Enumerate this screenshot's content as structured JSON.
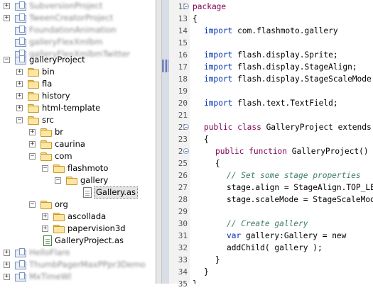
{
  "project_tree": {
    "blurred_top": [
      "SubversionProject",
      "TweenCreatorProject",
      "FoundationAnimation",
      "galleryFlexXmlbm",
      "galleryFlexXmlbmTwitter"
    ],
    "project_name": "galleryProject",
    "folders_top": [
      "bin",
      "fla",
      "history",
      "html-template"
    ],
    "src": "src",
    "src_children": [
      "br",
      "caurina",
      "com"
    ],
    "flashmoto": "flashmoto",
    "gallery": "gallery",
    "selected_file": "Gallery.as",
    "org": "org",
    "org_children": [
      "ascollada",
      "papervision3d"
    ],
    "main_file": "GalleryProject.as",
    "blurred_bottom": [
      "HelloFlare",
      "ThumbPagerMaxPPpr3Demo",
      "MxTimeWl"
    ]
  },
  "editor": {
    "line_numbers": [
      "12",
      "13",
      "14",
      "15",
      "16",
      "17",
      "18",
      "19",
      "20",
      "21",
      "22",
      "23",
      "24",
      "25",
      "26",
      "27",
      "28",
      "29",
      "30",
      "31",
      "32",
      "33",
      "34",
      "35"
    ],
    "lines": [
      {
        "kw": "package",
        "text": ""
      },
      {
        "kw": "",
        "text": "{"
      },
      {
        "kw": "import",
        "text": " com.flashmoto.gallery"
      },
      {
        "kw": "",
        "text": ""
      },
      {
        "kw": "import",
        "text": " flash.display.Sprite;"
      },
      {
        "kw": "import",
        "text": " flash.display.StageAlign;"
      },
      {
        "kw": "import",
        "text": " flash.display.StageScaleMode;"
      },
      {
        "kw": "",
        "text": ""
      },
      {
        "kw": "import",
        "text": " flash.text.TextField;"
      },
      {
        "kw": "",
        "text": ""
      },
      {
        "kw": "public class",
        "text": " GalleryProject extends"
      },
      {
        "kw": "",
        "text": "{"
      },
      {
        "kw": "public function",
        "text": " GalleryProject()"
      },
      {
        "kw": "",
        "text": "{"
      },
      {
        "kw": "",
        "text": "// Set some stage properties",
        "comment": true
      },
      {
        "kw": "",
        "text": "stage.align = StageAlign.TOP_LEFT;"
      },
      {
        "kw": "",
        "text": "stage.scaleMode = StageScaleMode;"
      },
      {
        "kw": "",
        "text": ""
      },
      {
        "kw": "",
        "text": "// Create gallery",
        "comment": true
      },
      {
        "kw": "var",
        "text": " gallery:Gallery = new"
      },
      {
        "kw": "",
        "text": "addChild( gallery );"
      },
      {
        "kw": "",
        "text": "}"
      },
      {
        "kw": "",
        "text": "}"
      },
      {
        "kw": "",
        "text": "}"
      }
    ]
  },
  "colors": {
    "keyword": "#0000c0",
    "comment": "#3f7f5f",
    "folder": "#fce6a4"
  }
}
